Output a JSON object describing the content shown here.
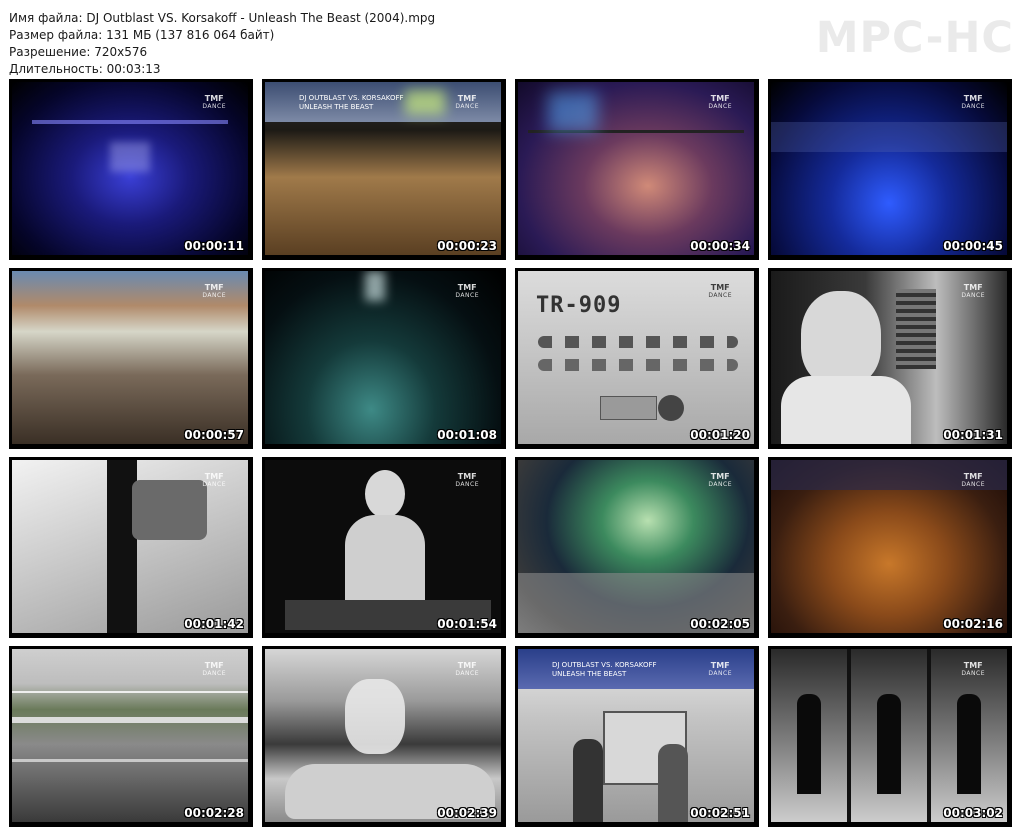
{
  "info": {
    "filename": "Имя файла: DJ Outblast VS. Korsakoff - Unleash The Beast (2004).mpg",
    "filesize": "Размер файла: 131 МБ (137 816 064 байт)",
    "resolution": "Разрешение: 720x576",
    "duration": "Длительность: 00:03:13"
  },
  "brand": "MPC-HC",
  "overlay": {
    "logo_top": "TMF",
    "logo_sub": "DANCE",
    "banner_line1": "DJ OUTBLAST VS. KORSAKOFF",
    "banner_line2": "UNLEASH THE BEAST",
    "tr909": "TR-909"
  },
  "thumbnails": [
    {
      "time": "00:00:11",
      "scene": "stage-lights-blue"
    },
    {
      "time": "00:00:23",
      "scene": "crowd-with-banner"
    },
    {
      "time": "00:00:34",
      "scene": "stage-truss-haze"
    },
    {
      "time": "00:00:45",
      "scene": "arena-blue-lights"
    },
    {
      "time": "00:00:57",
      "scene": "crowd-wide"
    },
    {
      "time": "00:01:08",
      "scene": "dark-tunnel"
    },
    {
      "time": "00:01:20",
      "scene": "drum-machine"
    },
    {
      "time": "00:01:31",
      "scene": "dj-portrait"
    },
    {
      "time": "00:01:42",
      "scene": "walking-with-bag"
    },
    {
      "time": "00:01:54",
      "scene": "female-dj-headphones"
    },
    {
      "time": "00:02:05",
      "scene": "crowd-lights-green"
    },
    {
      "time": "00:02:16",
      "scene": "crowd-orange"
    },
    {
      "time": "00:02:28",
      "scene": "road-motion"
    },
    {
      "time": "00:02:39",
      "scene": "convertible-car"
    },
    {
      "time": "00:02:51",
      "scene": "couple-at-sign"
    },
    {
      "time": "00:03:02",
      "scene": "man-in-corridor-triptych"
    }
  ]
}
